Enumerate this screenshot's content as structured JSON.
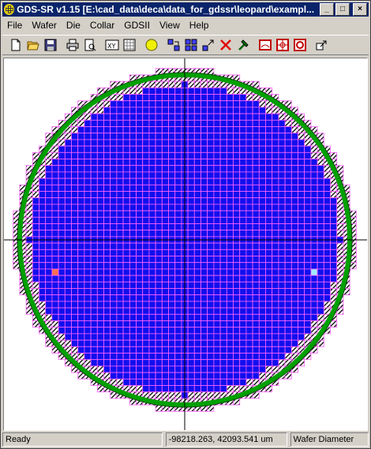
{
  "window": {
    "title": "GDS-SR v1.15 [E:\\cad_data\\deca\\data_for_gdssr\\leopard\\exampl..."
  },
  "title_buttons": {
    "minimize": "_",
    "maximize": "□",
    "close": "×"
  },
  "menu": [
    "File",
    "Wafer",
    "Die",
    "Collar",
    "GDSII",
    "View",
    "Help"
  ],
  "toolbar": {
    "icons": [
      "new-icon",
      "open-icon",
      "save-icon",
      "print-icon",
      "print-preview-icon",
      "xy-icon",
      "grid-icon",
      "wafer-icon",
      "select-icon",
      "layout-icon",
      "zoom-icon",
      "delete-icon",
      "hammer-icon",
      "wafer-edge-icon",
      "die-center-icon",
      "circle-icon",
      "export-icon"
    ]
  },
  "colors": {
    "wafer_border": "#00a000",
    "die_fill": "#1010ee",
    "die_grid": "#ff60ff",
    "partial_die": "#ffd700",
    "highlight_left": "#ff7050",
    "highlight_right": "#a0e8ff"
  },
  "status": {
    "left": "Ready",
    "coords": "-98218.263, 42093.541 um",
    "mode": "Wafer Diameter"
  }
}
